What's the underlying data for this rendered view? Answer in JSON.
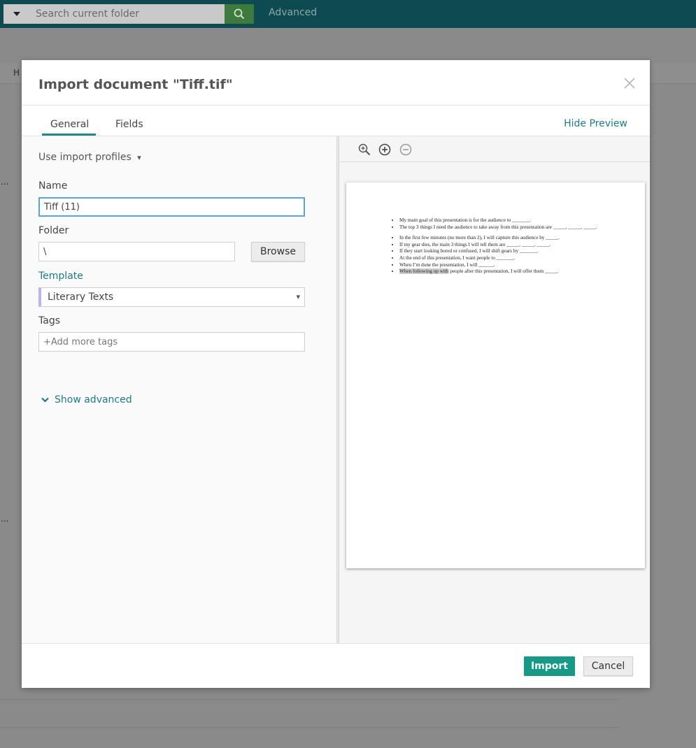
{
  "topbar": {
    "search_placeholder": "Search current folder",
    "advanced_label": "Advanced"
  },
  "background": {
    "column_fragment": "H",
    "ellipsis": "..."
  },
  "modal": {
    "title": "Import document \"Tiff.tif\"",
    "tabs": [
      {
        "label": "General",
        "active": true
      },
      {
        "label": "Fields",
        "active": false
      }
    ],
    "hide_preview_label": "Hide Preview",
    "form": {
      "profiles_label": "Use import profiles",
      "profiles_caret": "▾",
      "name_label": "Name",
      "name_value": "Tiff (11)",
      "folder_label": "Folder",
      "folder_value": "\\",
      "browse_label": "Browse",
      "template_label": "Template",
      "template_value": "Literary Texts",
      "select_arrow": "▾",
      "tags_label": "Tags",
      "tags_placeholder": "+Add more tags",
      "show_advanced_label": "Show advanced"
    },
    "preview": {
      "lines": [
        "My main goal of this presentation is for the audience to _______.",
        "The top 3 things I need the audience to take away from this presentation are _____, _____, _____.",
        "In the first few minutes (no more than 2), I will capture this audience by _____.",
        "If my gear dies, the main 3 things I will tell them are _____, _____, _____.",
        "If they start looking bored or confused, I will shift gears by _______.",
        "At the end of this presentation, I want people to _______.",
        "When I’m done the presentation, I will ______."
      ],
      "last_line_highlight": "When following up with",
      "last_line_rest": " people after this presentation, I will offer them _____."
    },
    "footer": {
      "import_label": "Import",
      "cancel_label": "Cancel"
    }
  },
  "colors": {
    "topbar": "#0d4a52",
    "accent_teal": "#1a7d86",
    "import_button": "#149a86",
    "template_bar": "#b9b4ef"
  }
}
